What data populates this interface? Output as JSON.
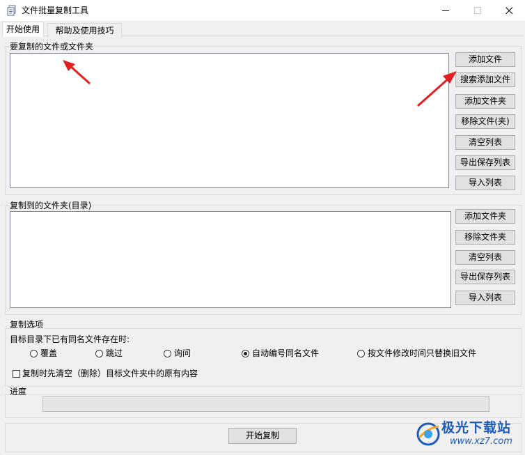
{
  "window": {
    "title": "文件批量复制工具"
  },
  "tabs": [
    {
      "label": "开始使用",
      "active": true
    },
    {
      "label": "帮助及使用技巧",
      "active": false
    }
  ],
  "source_group": {
    "legend": "要复制的文件或文件夹",
    "buttons": [
      "添加文件",
      "搜索添加文件",
      "添加文件夹",
      "移除文件(夹)",
      "清空列表",
      "导出保存列表",
      "导入列表"
    ]
  },
  "target_group": {
    "legend": "复制到的文件夹(目录)",
    "buttons": [
      "添加文件夹",
      "移除文件夹",
      "清空列表",
      "导出保存列表",
      "导入列表"
    ]
  },
  "options": {
    "legend": "复制选项",
    "prompt": "目标目录下已有同名文件存在时:",
    "radios": [
      "覆盖",
      "跳过",
      "询问",
      "自动编号同名文件",
      "按文件修改时间只替换旧文件"
    ],
    "selected_radio": "自动编号同名文件",
    "checkbox_label": "复制时先清空（删除）目标文件夹中的原有内容",
    "checkbox_checked": false
  },
  "progress": {
    "legend": "进度",
    "value": 0
  },
  "start_button": "开始复制",
  "watermark": {
    "name": "极光下载站",
    "url": "www.xz7.com"
  },
  "colors": {
    "arrow": "#e02020",
    "watermark": "#1d5bb8"
  }
}
